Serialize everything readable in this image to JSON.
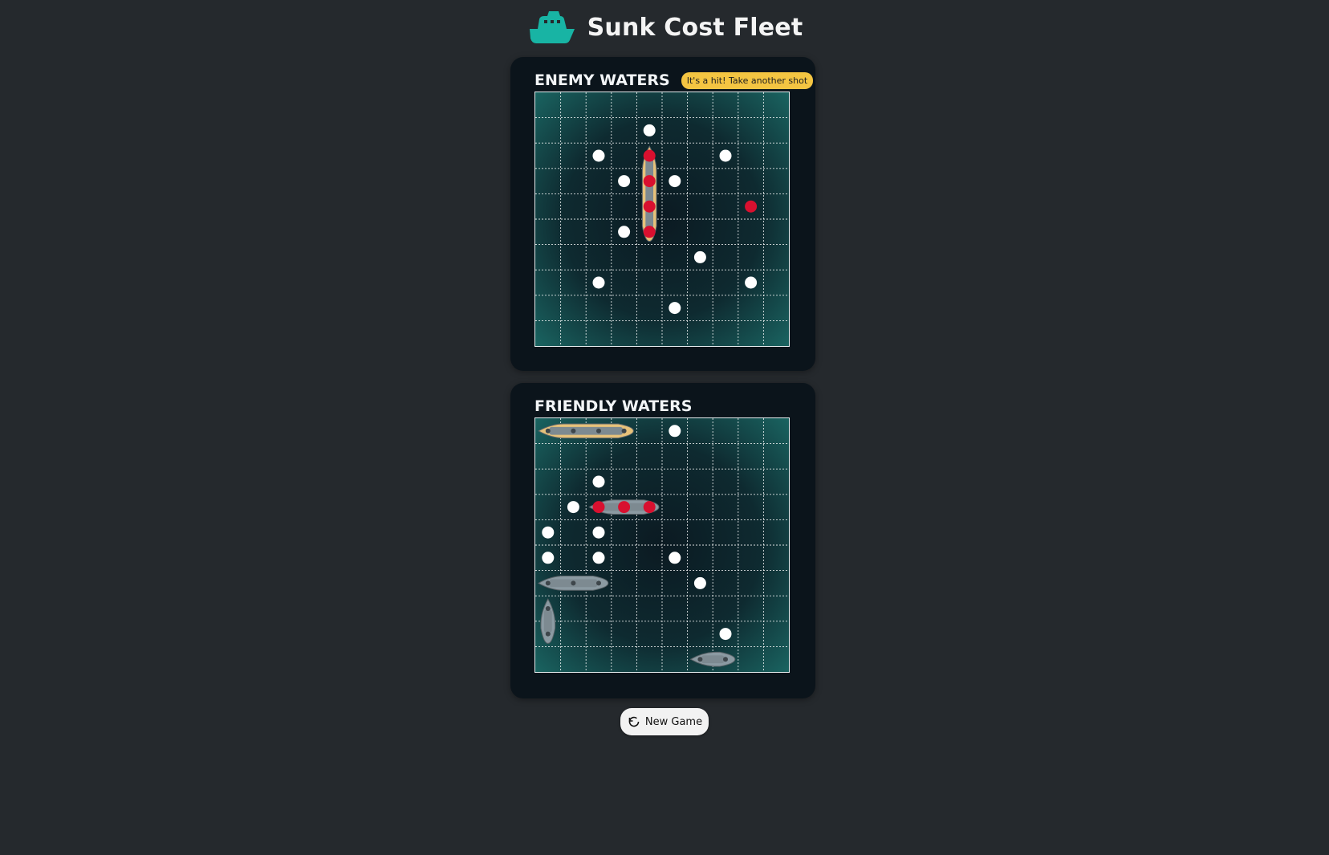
{
  "header": {
    "title": "Sunk Cost Fleet",
    "logo_icon": "ship-icon",
    "logo_color": "#18b4a4"
  },
  "enemy": {
    "title": "ENEMY WATERS",
    "status": "It's a hit! Take another shot",
    "status_color": "#f4c542",
    "grid_size": 10,
    "visible_ships": [
      {
        "row": 2,
        "col": 4,
        "length": 4,
        "orientation": "vertical",
        "sunk": false,
        "hull_color": "#e7c27a"
      }
    ],
    "hits": [
      [
        2,
        4
      ],
      [
        3,
        4
      ],
      [
        4,
        4
      ],
      [
        5,
        4
      ],
      [
        4,
        8
      ]
    ],
    "misses": [
      [
        1,
        4
      ],
      [
        2,
        2
      ],
      [
        2,
        7
      ],
      [
        3,
        3
      ],
      [
        3,
        5
      ],
      [
        5,
        3
      ],
      [
        6,
        6
      ],
      [
        7,
        2
      ],
      [
        7,
        8
      ],
      [
        8,
        5
      ]
    ]
  },
  "friendly": {
    "title": "FRIENDLY WATERS",
    "grid_size": 10,
    "ships": [
      {
        "row": 0,
        "col": 0,
        "length": 4,
        "orientation": "horizontal",
        "hull_color": "#e7c27a"
      },
      {
        "row": 3,
        "col": 2,
        "length": 3,
        "orientation": "horizontal",
        "hull_color": "#8b9aa2"
      },
      {
        "row": 6,
        "col": 0,
        "length": 3,
        "orientation": "horizontal",
        "hull_color": "#8b9aa2"
      },
      {
        "row": 7,
        "col": 0,
        "length": 2,
        "orientation": "vertical",
        "hull_color": "#8b9aa2"
      },
      {
        "row": 9,
        "col": 6,
        "length": 2,
        "orientation": "horizontal",
        "hull_color": "#8b9aa2"
      }
    ],
    "hits": [
      [
        3,
        2
      ],
      [
        3,
        3
      ],
      [
        3,
        4
      ]
    ],
    "misses": [
      [
        0,
        5
      ],
      [
        2,
        2
      ],
      [
        3,
        1
      ],
      [
        4,
        0
      ],
      [
        4,
        2
      ],
      [
        5,
        0
      ],
      [
        5,
        2
      ],
      [
        5,
        5
      ],
      [
        6,
        6
      ],
      [
        8,
        7
      ]
    ]
  },
  "colors": {
    "hit": "#d8102f",
    "miss": "#ffffff",
    "gridline": "#ffffff"
  },
  "footer": {
    "new_game_label": "New Game",
    "new_game_icon": "refresh-icon"
  }
}
